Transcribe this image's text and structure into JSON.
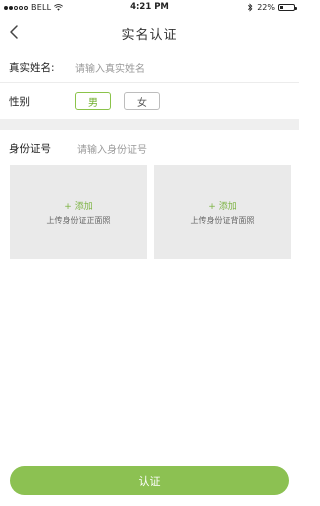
{
  "status_bar": {
    "carrier": "BELL",
    "time": "4:21 PM",
    "battery_percent": "22%",
    "battery_level": 0.22,
    "signal_bars_filled": 2,
    "signal_bars_total": 5
  },
  "nav": {
    "title": "实名认证",
    "back_icon": "chevron-left-icon"
  },
  "form": {
    "name_label": "真实姓名:",
    "name_placeholder": "请输入真实姓名",
    "gender_label": "性别",
    "gender_options": [
      "男",
      "女"
    ],
    "gender_selected": "男",
    "id_label": "身份证号",
    "id_placeholder": "请输入身份证号"
  },
  "uploads": {
    "front": {
      "add": "+ 添加",
      "label": "上传身份证正面照"
    },
    "back": {
      "add": "+ 添加",
      "label": "上传身份证背面照"
    }
  },
  "submit_label": "认证",
  "colors": {
    "accent": "#8cc152",
    "accent_text": "#6fae2b",
    "upload_bg": "#eaeaea",
    "divider_band": "#efefef"
  }
}
